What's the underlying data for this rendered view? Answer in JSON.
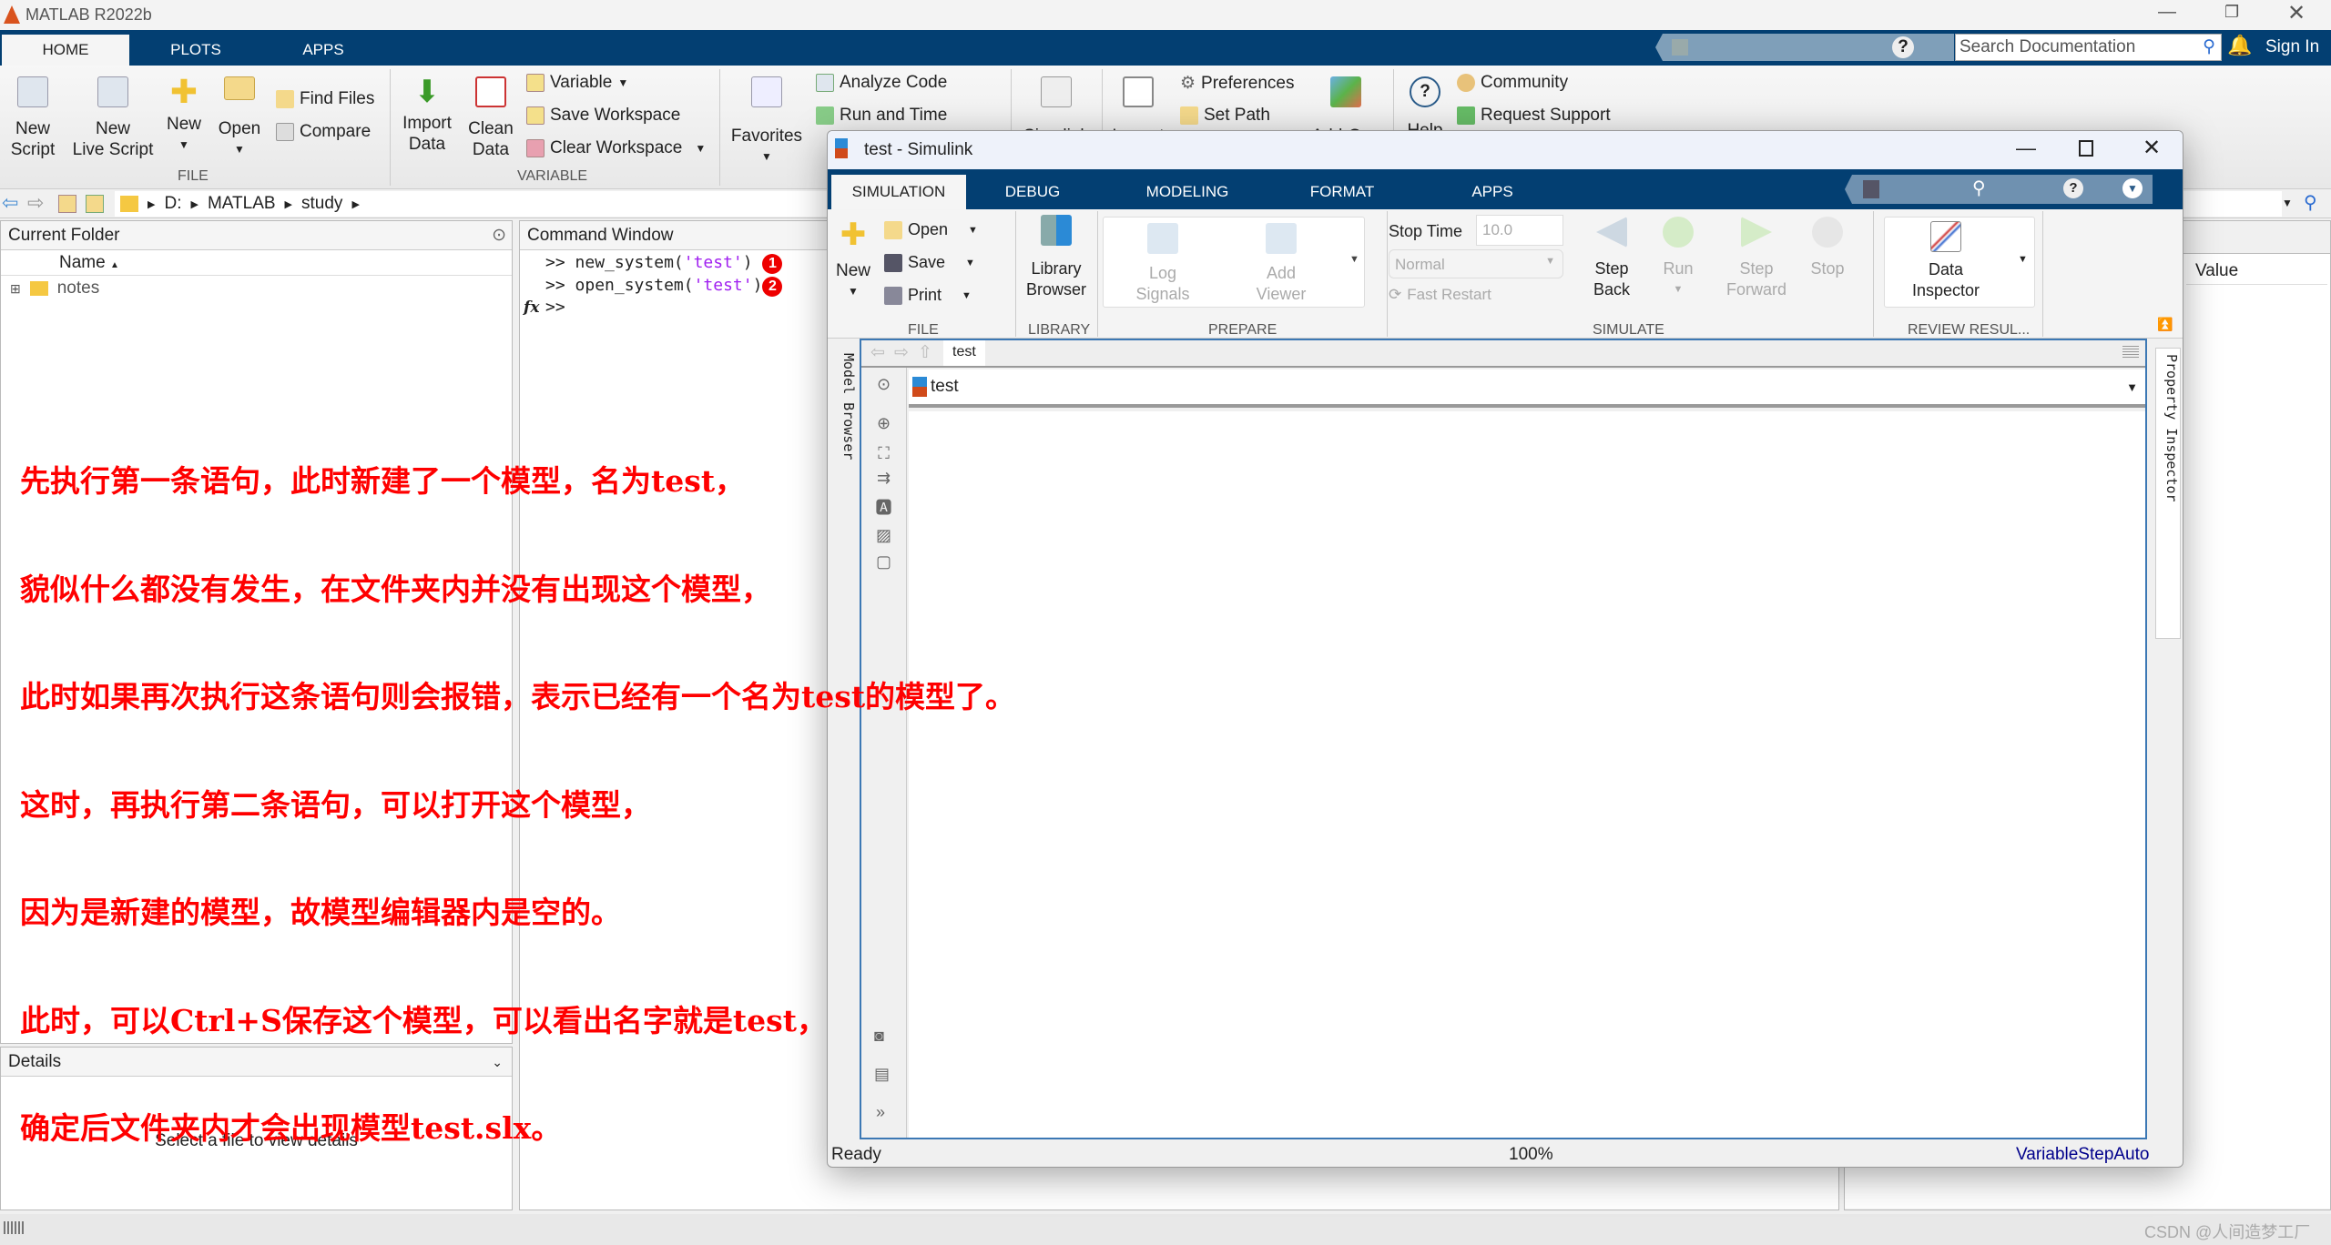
{
  "app": {
    "title": "MATLAB R2022b",
    "tabs": [
      "HOME",
      "PLOTS",
      "APPS"
    ],
    "active_tab": "HOME",
    "search_placeholder": "Search Documentation",
    "sign_in": "Sign In"
  },
  "toolstrip": {
    "file": {
      "label": "FILE",
      "new_script": "New\nScript",
      "new_live_script": "New\nLive Script",
      "new": "New",
      "open": "Open",
      "find_files": "Find Files",
      "compare": "Compare"
    },
    "variable": {
      "label": "VARIABLE",
      "import_data": "Import\nData",
      "clean_data": "Clean\nData",
      "variable": "Variable",
      "save_workspace": "Save Workspace",
      "clear_workspace": "Clear Workspace"
    },
    "code": {
      "favorites": "Favorites",
      "analyze_code": "Analyze Code",
      "run_and_time": "Run and Time"
    },
    "simulink": "Simulink",
    "layout": "Layout",
    "preferences": "Preferences",
    "set_path": "Set Path",
    "add_ons": "Add-Ons",
    "help": "Help",
    "community": "Community",
    "request_support": "Request Support"
  },
  "address": {
    "path": [
      "D:",
      "MATLAB",
      "study"
    ]
  },
  "current_folder": {
    "title": "Current Folder",
    "column": "Name",
    "items": [
      {
        "name": "notes",
        "type": "folder"
      }
    ]
  },
  "details": {
    "title": "Details",
    "empty_text": "Select a file to view details"
  },
  "command_window": {
    "title": "Command Window",
    "lines": [
      {
        "prompt": ">>",
        "fn": "new_system(",
        "arg": "'test'",
        "close": ")",
        "badge": "1"
      },
      {
        "prompt": ">>",
        "fn": "open_system(",
        "arg": "'test'",
        "close": ")",
        "badge": "2"
      }
    ],
    "prompt": ">>",
    "fx": "fx"
  },
  "workspace": {
    "column": "Value"
  },
  "annotation": {
    "color": "#ff0000",
    "lines": [
      "先执行第一条语句，此时新建了一个模型，名为test，",
      "貌似什么都没有发生，在文件夹内并没有出现这个模型，",
      "此时如果再次执行这条语句则会报错，表示已经有一个名为test的模型了。",
      "这时，再执行第二条语句，可以打开这个模型，",
      "因为是新建的模型，故模型编辑器内是空的。",
      "此时，可以Ctrl+S保存这个模型，可以看出名字就是test，",
      "确定后文件夹内才会出现模型test.slx。"
    ]
  },
  "simulink": {
    "title": "test - Simulink",
    "tabs": [
      "SIMULATION",
      "DEBUG",
      "MODELING",
      "FORMAT",
      "APPS"
    ],
    "active_tab": "SIMULATION",
    "file": {
      "label": "FILE",
      "new": "New",
      "open": "Open",
      "save": "Save",
      "print": "Print"
    },
    "library": {
      "label": "LIBRARY",
      "library_browser": "Library\nBrowser"
    },
    "prepare": {
      "label": "PREPARE",
      "log_signals": "Log\nSignals",
      "add_viewer": "Add\nViewer"
    },
    "simulate": {
      "label": "SIMULATE",
      "stop_time_label": "Stop Time",
      "stop_time": "10.0",
      "mode": "Normal",
      "fast_restart": "Fast Restart",
      "step_back": "Step\nBack",
      "run": "Run",
      "step_forward": "Step\nForward",
      "stop": "Stop"
    },
    "review": {
      "label": "REVIEW RESUL...",
      "data_inspector": "Data\nInspector"
    },
    "breadcrumb_tab": "test",
    "model_path": "test",
    "model_browser": "Model Browser",
    "property_inspector": "Property Inspector",
    "status": {
      "state": "Ready",
      "zoom": "100%",
      "solver": "VariableStepAuto"
    }
  },
  "watermark": "CSDN @人间造梦工厂",
  "colors": {
    "tabbar": "#033f72",
    "accent": "#3c78b4",
    "string": "#a020f0",
    "badge": "#e00000",
    "solver": "#00008b"
  }
}
